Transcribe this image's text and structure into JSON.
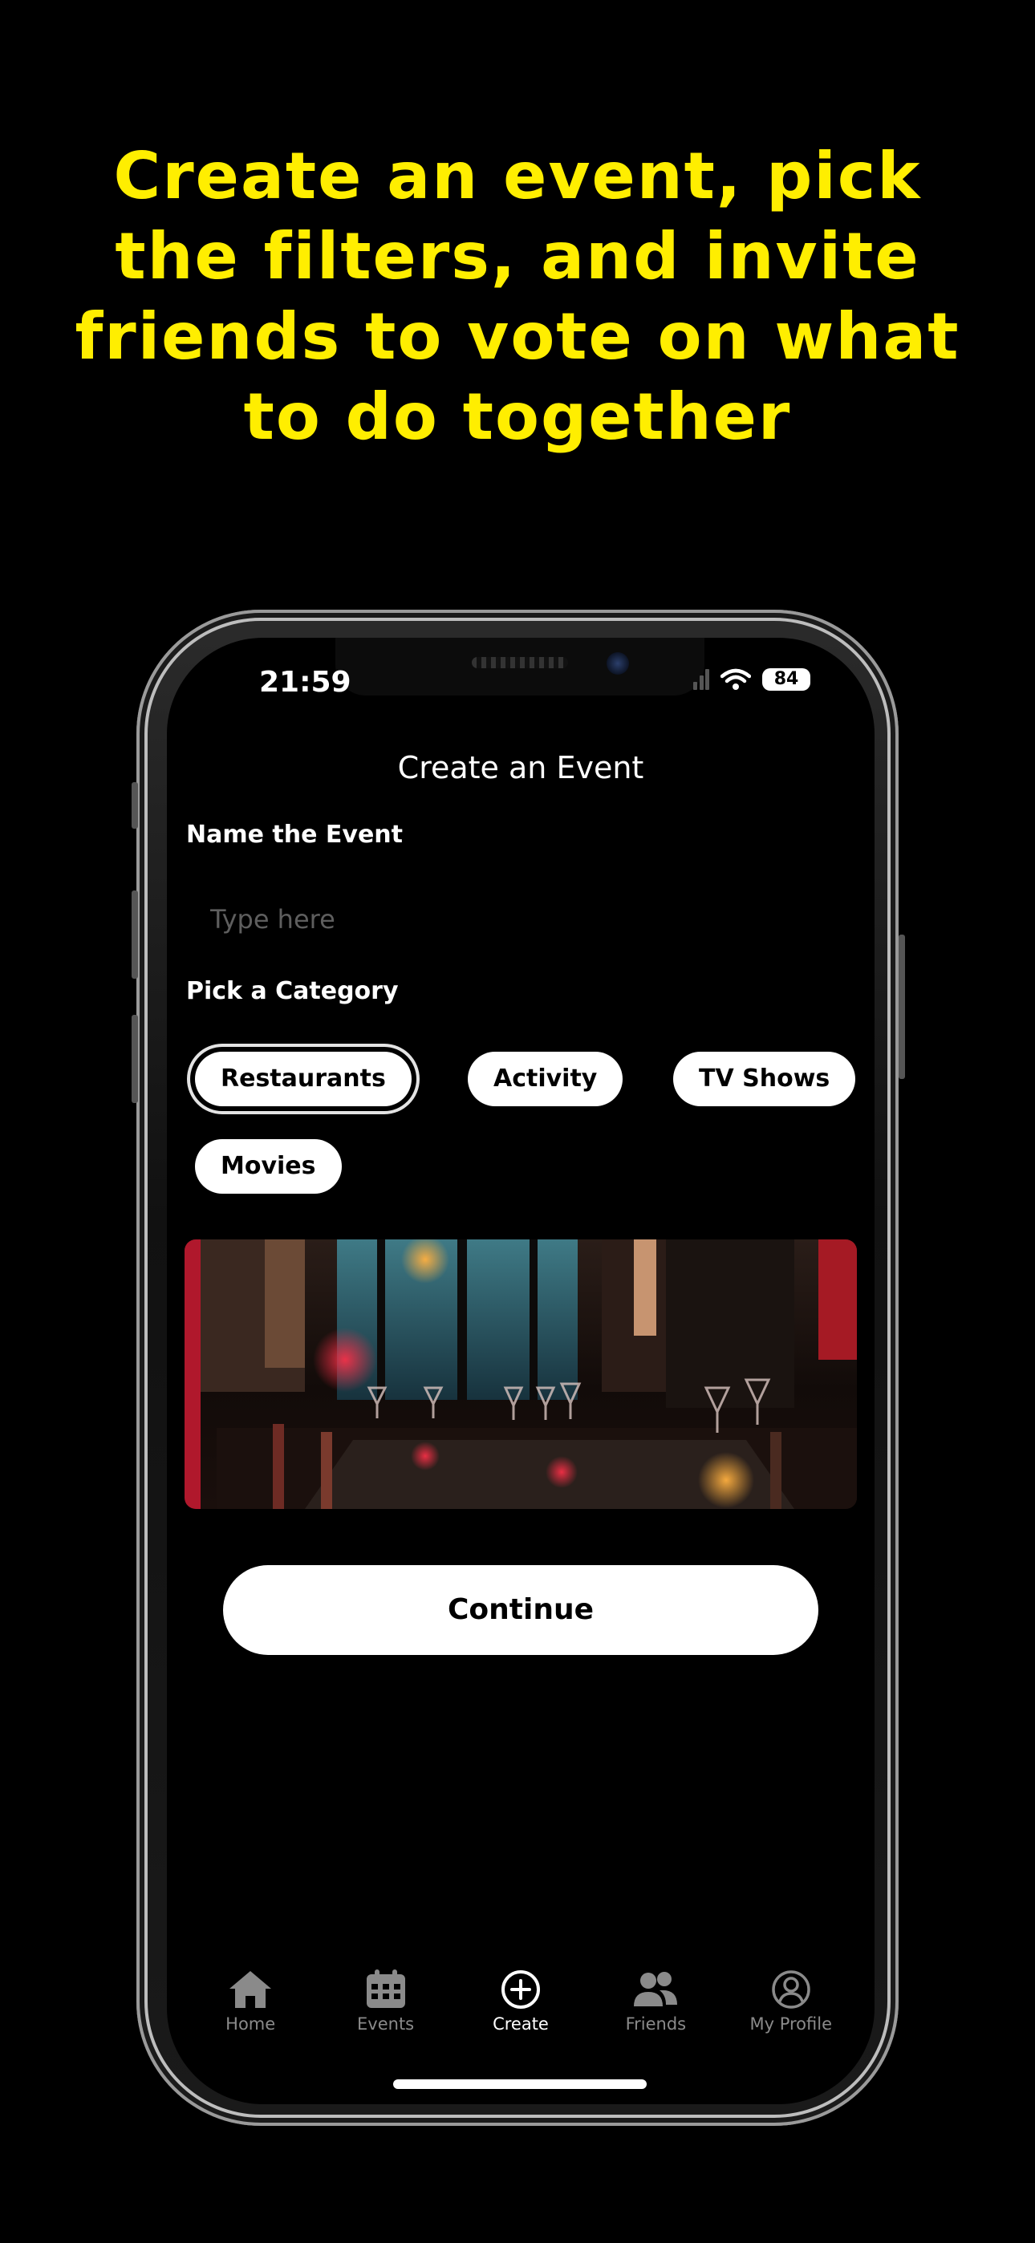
{
  "headline": "Create an event, pick the filters, and invite friends to vote on what to do together",
  "status_bar": {
    "time": "21:59",
    "battery": "84"
  },
  "screen": {
    "title": "Create an Event",
    "name_label": "Name the Event",
    "name_placeholder": "Type here",
    "category_label": "Pick a Category",
    "categories": [
      {
        "label": "Restaurants",
        "selected": true
      },
      {
        "label": "Activity",
        "selected": false
      },
      {
        "label": "TV Shows",
        "selected": false
      },
      {
        "label": "Movies",
        "selected": false
      }
    ],
    "continue_label": "Continue"
  },
  "tabs": [
    {
      "label": "Home",
      "icon": "home-icon",
      "active": false
    },
    {
      "label": "Events",
      "icon": "calendar-icon",
      "active": false
    },
    {
      "label": "Create",
      "icon": "plus-circle-icon",
      "active": true
    },
    {
      "label": "Friends",
      "icon": "people-icon",
      "active": false
    },
    {
      "label": "My Profile",
      "icon": "profile-icon",
      "active": false
    }
  ],
  "colors": {
    "headline": "#ffee00",
    "background": "#000000",
    "chip": "#ffffff",
    "tab_inactive": "#8a8a8a"
  }
}
